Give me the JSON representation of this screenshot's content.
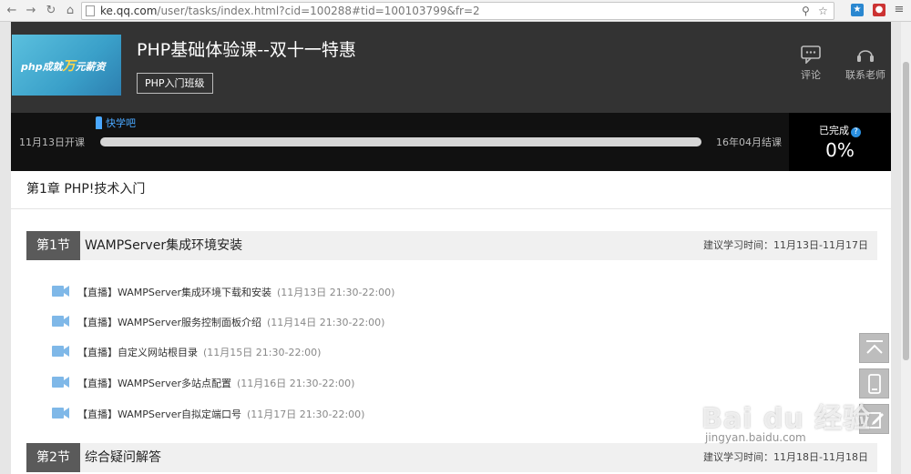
{
  "browser": {
    "url_host": "ke.qq.com",
    "url_path": "/user/tasks/index.html?cid=100288#tid=100103799&fr=2"
  },
  "header": {
    "logo_text_a": "php成就",
    "logo_text_b": "万",
    "logo_text_c": "元薪资",
    "course_title": "PHP基础体验课--双十一特惠",
    "class_tag": "PHP入门班级",
    "comment_label": "评论",
    "contact_label": "联系老师"
  },
  "progress": {
    "start_date": "11月13日开课",
    "end_date": "16年04月结课",
    "marker_label": "快学吧",
    "done_label": "已完成",
    "done_percent": "0%",
    "help_glyph": "?",
    "fraction": 0
  },
  "chapter": {
    "title": "第1章 PHP!技术入门"
  },
  "sections": [
    {
      "no": "第1节",
      "name": "WAMPServer集成环境安装",
      "time": "建议学习时间：11月13日-11月17日",
      "tasks": [
        {
          "title": "【直播】WAMPServer集成环境下载和安装",
          "time": "(11月13日 21:30-22:00)"
        },
        {
          "title": "【直播】WAMPServer服务控制面板介绍",
          "time": "(11月14日 21:30-22:00)"
        },
        {
          "title": "【直播】自定义网站根目录",
          "time": "(11月15日 21:30-22:00)"
        },
        {
          "title": "【直播】WAMPServer多站点配置",
          "time": "(11月16日 21:30-22:00)"
        },
        {
          "title": "【直播】WAMPServer自拟定端口号",
          "time": "(11月17日 21:30-22:00)"
        }
      ]
    },
    {
      "no": "第2节",
      "name": "综合疑问解答",
      "time": "建议学习时间：11月18日-11月18日",
      "tasks": []
    }
  ],
  "watermark": {
    "brand": "Bai du 经验",
    "url": "jingyan.baidu.com"
  },
  "colors": {
    "header_bg": "#333333",
    "accent": "#4aa8ff",
    "camera_icon": "#7fb8e8"
  },
  "icons": [
    "back-icon",
    "forward-icon",
    "reload-icon",
    "home-icon",
    "comment-icon",
    "headset-icon",
    "video-camera-icon",
    "back-to-top-icon",
    "mobile-icon",
    "edit-icon"
  ]
}
